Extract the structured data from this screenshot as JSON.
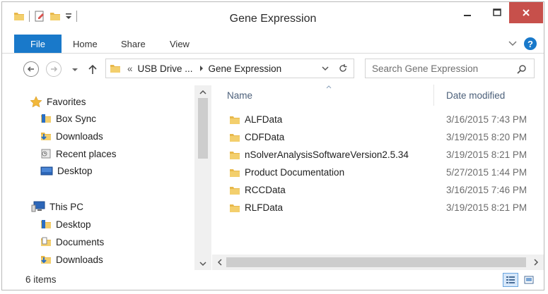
{
  "window": {
    "title": "Gene Expression"
  },
  "ribbon": {
    "file_label": "File",
    "tabs": [
      {
        "label": "Home"
      },
      {
        "label": "Share"
      },
      {
        "label": "View"
      }
    ]
  },
  "address": {
    "prefix": "«",
    "crumbs": [
      {
        "label": "USB Drive ..."
      },
      {
        "label": "Gene Expression"
      }
    ]
  },
  "search": {
    "placeholder": "Search Gene Expression"
  },
  "nav_pane": {
    "favorites_label": "Favorites",
    "favorites": [
      {
        "label": "Box Sync",
        "icon": "box-sync-folder-icon"
      },
      {
        "label": "Downloads",
        "icon": "downloads-icon"
      },
      {
        "label": "Recent places",
        "icon": "recent-places-icon"
      },
      {
        "label": "Desktop",
        "icon": "desktop-icon"
      }
    ],
    "thispc_label": "This PC",
    "thispc": [
      {
        "label": "Desktop",
        "icon": "folder-icon"
      },
      {
        "label": "Documents",
        "icon": "documents-icon"
      },
      {
        "label": "Downloads",
        "icon": "downloads-icon"
      }
    ]
  },
  "file_list": {
    "columns": {
      "name": "Name",
      "date": "Date modified"
    },
    "rows": [
      {
        "name": "ALFData",
        "date": "3/16/2015 7:43 PM"
      },
      {
        "name": "CDFData",
        "date": "3/19/2015 8:20 PM"
      },
      {
        "name": "nSolverAnalysisSoftwareVersion2.5.34",
        "date": "3/19/2015 8:21 PM"
      },
      {
        "name": "Product Documentation",
        "date": "5/27/2015 1:44 PM"
      },
      {
        "name": "RCCData",
        "date": "3/16/2015 7:46 PM"
      },
      {
        "name": "RLFData",
        "date": "3/19/2015 8:21 PM"
      }
    ]
  },
  "status": {
    "text": "6 items"
  },
  "colors": {
    "accent": "#1979ca",
    "close": "#c7504b",
    "folder": "#e8b84a",
    "header_text": "#4c607a"
  }
}
